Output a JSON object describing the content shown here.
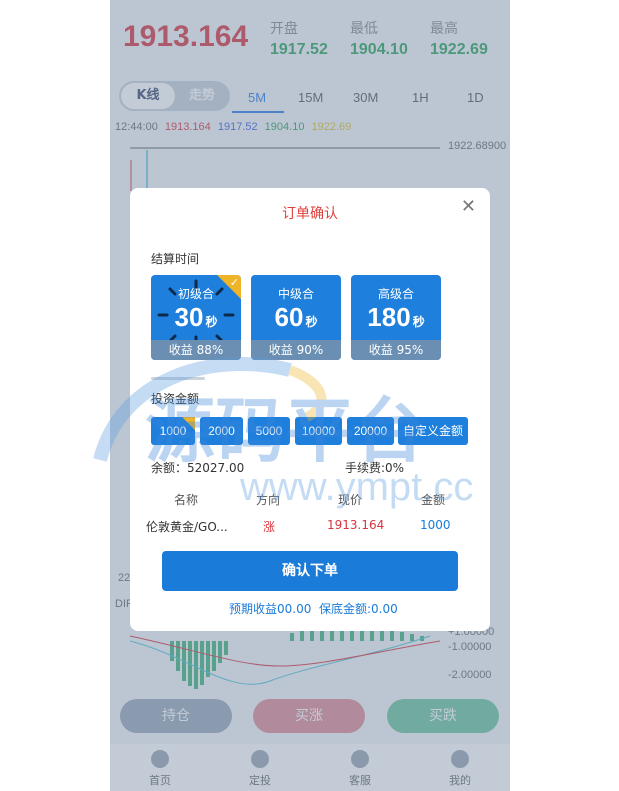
{
  "header": {
    "price": "1913.164",
    "stats": [
      {
        "label": "开盘",
        "value": "1917.52"
      },
      {
        "label": "最低",
        "value": "1904.10"
      },
      {
        "label": "最高",
        "value": "1922.69"
      }
    ]
  },
  "mode_toggle": {
    "active": "K线",
    "inactive": "走势"
  },
  "periods": [
    "5M",
    "15M",
    "30M",
    "1H",
    "1D"
  ],
  "selected_period": "5M",
  "ohlc": {
    "time": "12:44:00",
    "price": "1913.164",
    "open": "1917.52",
    "low": "1904.10",
    "high": "1922.69"
  },
  "chart_axis": {
    "top_value": "1922.68900",
    "left_partial": "22",
    "macd_label": "DIF",
    "macd_axis": [
      "+1.00000",
      "-1.00000",
      "-2.00000"
    ]
  },
  "bottom_buttons": {
    "hold": "持仓",
    "buy_up": "买涨",
    "buy_down": "买跌"
  },
  "tabbar": [
    "首页",
    "定投",
    "客服",
    "我的"
  ],
  "modal": {
    "title": "订单确认",
    "settle_label": "结算时间",
    "cards": [
      {
        "name": "初级合",
        "seconds": "30",
        "unit": "秒",
        "profit": "收益 88%",
        "selected": true
      },
      {
        "name": "中级合",
        "seconds": "60",
        "unit": "秒",
        "profit": "收益 90%",
        "selected": false
      },
      {
        "name": "高级合",
        "seconds": "180",
        "unit": "秒",
        "profit": "收益 95%",
        "selected": false
      }
    ],
    "amount_label": "投资金额",
    "amounts": [
      "1000",
      "2000",
      "5000",
      "10000",
      "20000",
      "自定义金额"
    ],
    "selected_amount": "1000",
    "balance": "余额：52027.00",
    "fee": "手续费:0%",
    "columns": [
      "名称",
      "方向",
      "现价",
      "金额"
    ],
    "row": {
      "name": "伦敦黄金/GO...",
      "direction": "涨",
      "price": "1913.164",
      "amount": "1000"
    },
    "confirm_label": "确认下单",
    "expected_profit": "预期收益00.00",
    "guarantee": "保底金额:0.00"
  },
  "watermark": {
    "cn": "源码平台",
    "url": "www.ympt.cc"
  },
  "colors": {
    "rise": "#d9343f",
    "fall": "#2aa35a",
    "primary": "#1f7fdc",
    "accent": "#f0b429"
  }
}
